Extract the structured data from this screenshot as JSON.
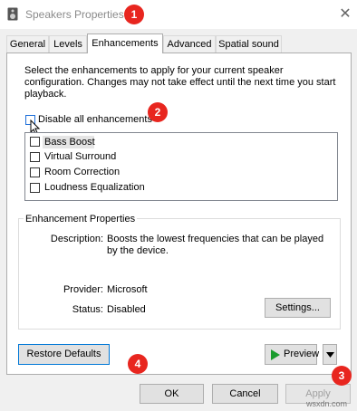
{
  "window": {
    "title": "Speakers Properties",
    "close_glyph": "✕"
  },
  "tabs": [
    {
      "label": "General"
    },
    {
      "label": "Levels"
    },
    {
      "label": "Enhancements",
      "active": true
    },
    {
      "label": "Advanced"
    },
    {
      "label": "Spatial sound"
    }
  ],
  "enhancements": {
    "description": "Select the enhancements to apply for your current speaker configuration. Changes may not take effect until the next time you start playback.",
    "disable_all_label": "Disable all enhancements",
    "disable_all_checked": false,
    "items": [
      {
        "label": "Bass Boost",
        "checked": false,
        "selected": true
      },
      {
        "label": "Virtual Surround",
        "checked": false
      },
      {
        "label": "Room Correction",
        "checked": false
      },
      {
        "label": "Loudness Equalization",
        "checked": false
      }
    ]
  },
  "properties": {
    "group_title": "Enhancement Properties",
    "description_label": "Description:",
    "description_value": "Boosts the lowest frequencies that can be played by the device.",
    "provider_label": "Provider:",
    "provider_value": "Microsoft",
    "status_label": "Status:",
    "status_value": "Disabled",
    "settings_button": "Settings..."
  },
  "footer": {
    "restore_defaults": "Restore Defaults",
    "preview": "Preview",
    "ok": "OK",
    "cancel": "Cancel",
    "apply": "Apply"
  },
  "annotations": {
    "marker1": "1",
    "marker2": "2",
    "marker3": "3",
    "marker4": "4"
  },
  "watermark": "wsxdn.com",
  "colors": {
    "marker": "#e8261f",
    "play": "#1a9c2e",
    "focus": "#0078d7"
  }
}
